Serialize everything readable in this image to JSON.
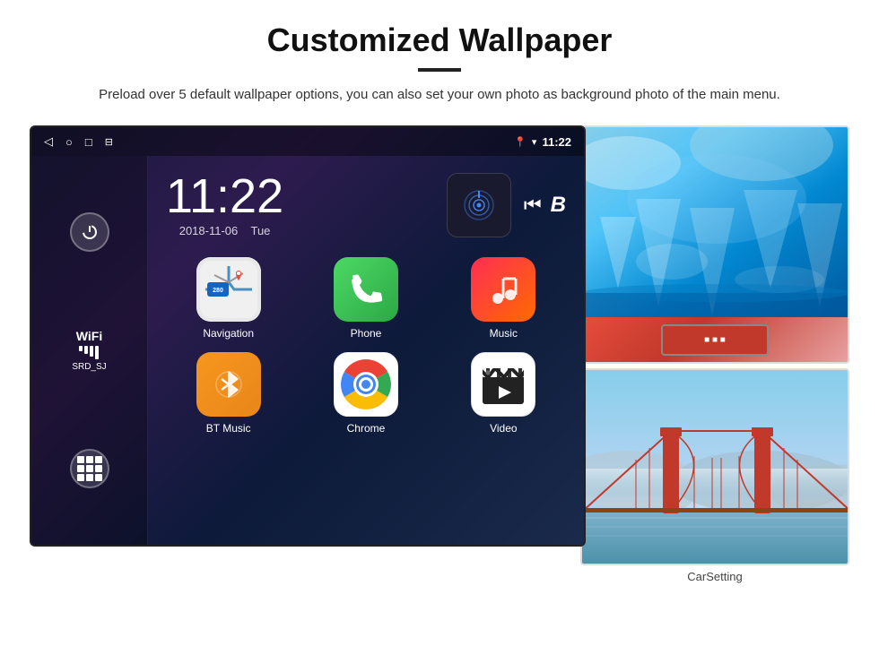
{
  "header": {
    "title": "Customized Wallpaper",
    "divider": true,
    "description": "Preload over 5 default wallpaper options, you can also set your own photo as background photo of the main menu."
  },
  "android_screen": {
    "status_bar": {
      "nav_icons": [
        "◁",
        "○",
        "□",
        "⊡"
      ],
      "right_icons": [
        "📍",
        "▼"
      ],
      "time": "11:22"
    },
    "clock": {
      "time": "11:22",
      "date": "2018-11-06",
      "day": "Tue"
    },
    "wifi": {
      "label": "WiFi",
      "ssid": "SRD_SJ"
    },
    "apps": [
      {
        "id": "navigation",
        "label": "Navigation",
        "type": "nav"
      },
      {
        "id": "phone",
        "label": "Phone",
        "type": "phone"
      },
      {
        "id": "music",
        "label": "Music",
        "type": "music"
      },
      {
        "id": "bt-music",
        "label": "BT Music",
        "type": "bt"
      },
      {
        "id": "chrome",
        "label": "Chrome",
        "type": "chrome"
      },
      {
        "id": "video",
        "label": "Video",
        "type": "video"
      }
    ]
  },
  "wallpapers": [
    {
      "id": "ice",
      "type": "ice",
      "label": ""
    },
    {
      "id": "bridge",
      "type": "bridge",
      "label": "CarSetting"
    }
  ],
  "colors": {
    "background": "#ffffff",
    "screen_bg": "#1a1a3e",
    "accent": "#222222"
  }
}
